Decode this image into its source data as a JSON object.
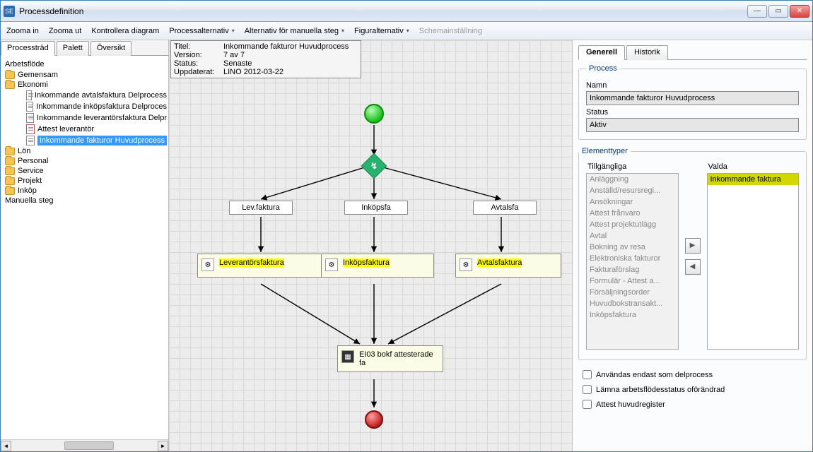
{
  "window": {
    "title": "Processdefinition"
  },
  "menu": {
    "zoom_in": "Zooma in",
    "zoom_out": "Zooma ut",
    "check_diagram": "Kontrollera diagram",
    "process_options": "Processalternativ",
    "manual_step_options": "Alternativ för manuella steg",
    "figure_options": "Figuralternativ",
    "schema_settings": "Schemainställning"
  },
  "left_tabs": {
    "tree": "Processträd",
    "palette": "Palett",
    "overview": "Översikt"
  },
  "tree": {
    "root": "Arbetsflöde",
    "gemensam": "Gemensam",
    "ekonomi": "Ekonomi",
    "items": {
      "i1": "Inkommande avtalsfaktura Delprocess",
      "i2": "Inkommande inköpsfaktura Delproces",
      "i3": "Inkommande leverantörsfaktura Delpr",
      "i4": "Attest leverantör",
      "i5": "Inkommande fakturor Huvudprocess"
    },
    "lon": "Lön",
    "personal": "Personal",
    "service": "Service",
    "projekt": "Projekt",
    "inkop": "Inköp",
    "manuella": "Manuella steg"
  },
  "info": {
    "title_lab": "Titel:",
    "title": "Inkommande fakturor Huvudprocess",
    "version_lab": "Version:",
    "version": "7 av 7",
    "status_lab": "Status:",
    "status": "Senaste",
    "updated_lab": "Uppdaterat:",
    "updated": "LINO  2012-03-22"
  },
  "nodes": {
    "lev_small": "Lev.faktura",
    "inkop_small": "Inköpsfa",
    "avtal_small": "Avtalsfa",
    "lev": "Leverantörsfaktura",
    "inkop": "Inköpsfaktura",
    "avtal": "Avtalsfaktura",
    "task": "EI03 bokf attesterade fa"
  },
  "right_tabs": {
    "general": "Generell",
    "history": "Historik"
  },
  "process_group": {
    "legend": "Process",
    "name_label": "Namn",
    "name_value": "Inkommande fakturor Huvudprocess",
    "status_label": "Status",
    "status_value": "Aktiv"
  },
  "element_types": {
    "legend": "Elementtyper",
    "available_header": "Tillgängliga",
    "selected_header": "Valda",
    "available": [
      "Anläggning",
      "Anställd/resursregi...",
      "Ansökningar",
      "Attest frånvaro",
      "Attest projektutlägg",
      "Avtal",
      "Bokning av resa",
      "Elektroniska fakturor",
      "Fakturaförslag",
      "Formulär - Attest a...",
      "Försäljningsorder",
      "Huvudbokstransakt...",
      "Inköpsfaktura"
    ],
    "selected": [
      "Inkommande faktura"
    ]
  },
  "checks": {
    "c1": "Användas endast som delprocess",
    "c2": "Lämna arbetsflödesstatus oförändrad",
    "c3": "Attest huvudregister"
  }
}
